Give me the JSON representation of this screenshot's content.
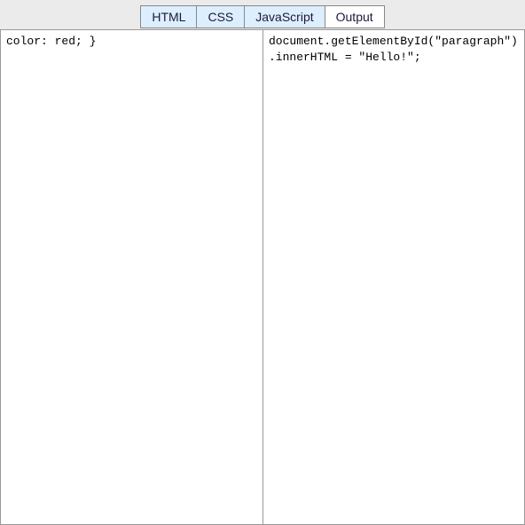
{
  "tabs": {
    "html": "HTML",
    "css": "CSS",
    "javascript": "JavaScript",
    "output": "Output"
  },
  "panes": {
    "left": "color: red; }",
    "right": "document.getElementById(\"paragraph\").innerHTML = \"Hello!\";"
  }
}
